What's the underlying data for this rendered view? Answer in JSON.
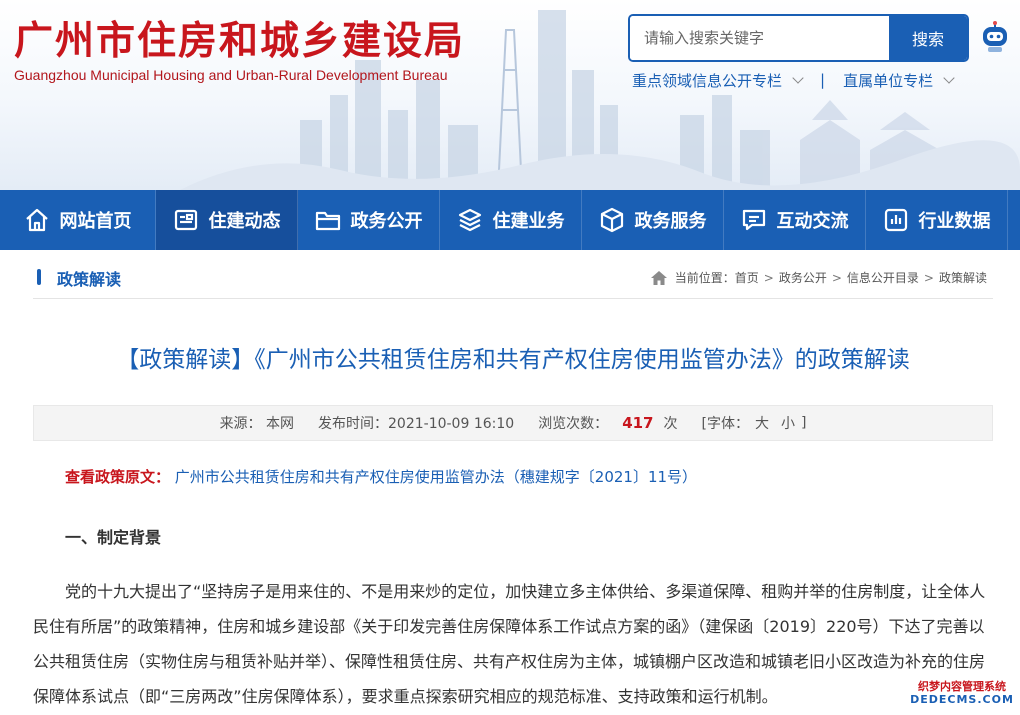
{
  "header": {
    "title": "广州市住房和城乡建设局",
    "subtitle": "Guangzhou Municipal Housing and Urban-Rural Development Bureau",
    "search": {
      "placeholder": "请输入搜索关键字",
      "button_label": "搜索"
    },
    "quick_links": [
      "重点领域信息公开专栏",
      "直属单位专栏"
    ],
    "separator": "|"
  },
  "nav": {
    "items": [
      {
        "label": "网站首页",
        "icon": "home-icon"
      },
      {
        "label": "住建动态",
        "icon": "news-icon"
      },
      {
        "label": "政务公开",
        "icon": "folder-icon"
      },
      {
        "label": "住建业务",
        "icon": "layers-icon"
      },
      {
        "label": "政务服务",
        "icon": "cube-icon"
      },
      {
        "label": "互动交流",
        "icon": "chat-icon"
      },
      {
        "label": "行业数据",
        "icon": "chart-icon"
      }
    ],
    "active_index": 1
  },
  "section": {
    "title": "政策解读",
    "breadcrumb_prefix": "当前位置：",
    "breadcrumbs": [
      "首页",
      "政务公开",
      "信息公开目录",
      "政策解读"
    ],
    "crumb_sep": ">"
  },
  "article": {
    "title": "【政策解读】《广州市公共租赁住房和共有产权住房使用监管办法》的政策解读",
    "meta": {
      "source": "来源： 本网",
      "publish_time": "发布时间：2021-10-09 16:10",
      "views_label": "浏览次数：",
      "views": "417",
      "views_unit": "次",
      "font_open": "[字体：",
      "font_large": "大",
      "font_small": "小",
      "font_close": "]"
    },
    "source_label": "查看政策原文：",
    "source_link": "广州市公共租赁住房和共有产权住房使用监管办法（穗建规字〔2021〕11号）",
    "heading": "一、制定背景",
    "paragraph": "党的十九大提出了“坚持房子是用来住的、不是用来炒的定位，加快建立多主体供给、多渠道保障、租购并举的住房制度，让全体人民住有所居”的政策精神，住房和城乡建设部《关于印发完善住房保障体系工作试点方案的函》（建保函〔2019〕220号）下达了完善以公共租赁住房（实物住房与租赁补贴并举）、保障性租赁住房、共有产权住房为主体，城镇棚户区改造和城镇老旧小区改造为补充的住房保障体系试点（即“三房两改”住房保障体系），要求重点探索研究相应的规范标准、支持政策和运行机制。"
  },
  "watermark": {
    "line1": "织梦内容管理系统",
    "line2": "DEDECMS.COM"
  },
  "colors": {
    "brand_red": "#c8161d",
    "brand_blue": "#1a5fb4",
    "nav_active": "#164f9c"
  }
}
